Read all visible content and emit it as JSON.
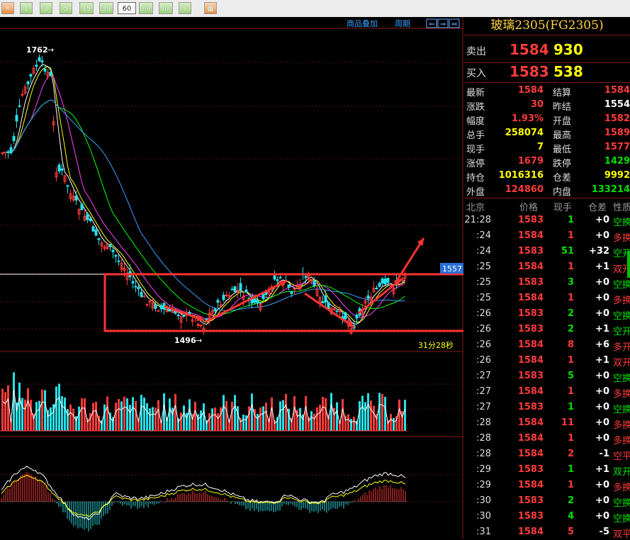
{
  "toolbar": {
    "buttons": [
      "1",
      "3",
      "5",
      "15",
      "30",
      "60",
      "2hr",
      "4hr",
      "Y"
    ],
    "active": "60"
  },
  "chart": {
    "links": [
      "商品叠加",
      "周期"
    ],
    "peak_label": "1762",
    "trough_label": "1496",
    "price_tag": "1557",
    "countdown": "31分28秒",
    "annotation_color": "#ff3333"
  },
  "panel": {
    "title": "玻璃2305(FG2305)",
    "sell": {
      "label": "卖出",
      "price": "1584",
      "volume": "930"
    },
    "buy": {
      "label": "买入",
      "price": "1583",
      "volume": "538"
    },
    "stats": [
      {
        "l1": "最新",
        "v1": "1584",
        "c1": "#ff3b3b",
        "l2": "结算",
        "v2": "1584",
        "c2": "#ff3b3b"
      },
      {
        "l1": "涨跌",
        "v1": "30",
        "c1": "#ff3b3b",
        "l2": "昨结",
        "v2": "1554",
        "c2": "#ffffff"
      },
      {
        "l1": "幅度",
        "v1": "1.93%",
        "c1": "#ff3b3b",
        "l2": "开盘",
        "v2": "1582",
        "c2": "#ff3b3b"
      },
      {
        "l1": "总手",
        "v1": "258074",
        "c1": "#ffff00",
        "l2": "最高",
        "v2": "1589",
        "c2": "#ff3b3b"
      },
      {
        "l1": "现手",
        "v1": "7",
        "c1": "#ffff00",
        "l2": "最低",
        "v2": "1577",
        "c2": "#ff3b3b"
      },
      {
        "l1": "涨停",
        "v1": "1679",
        "c1": "#ff3b3b",
        "l2": "跌停",
        "v2": "1429",
        "c2": "#00e000"
      },
      {
        "l1": "持仓",
        "v1": "1016316",
        "c1": "#ffff00",
        "l2": "仓差",
        "v2": "9992",
        "c2": "#ffff00"
      },
      {
        "l1": "外盘",
        "v1": "124860",
        "c1": "#ff3b3b",
        "l2": "内盘",
        "v2": "133214",
        "c2": "#00e000"
      }
    ],
    "tick_headers": [
      "北京",
      "价格",
      "现手",
      "仓差",
      "性质"
    ],
    "ticks": [
      {
        "time": "21:28",
        "price": "1583",
        "vol": "1",
        "vol_color": "#00e000",
        "diff": "+0",
        "kind": "空换",
        "kind_color": "#00e000"
      },
      {
        "time": ":24",
        "price": "1584",
        "vol": "1",
        "vol_color": "#ff3b3b",
        "diff": "+0",
        "kind": "多换",
        "kind_color": "#ff3b3b"
      },
      {
        "time": ":24",
        "price": "1583",
        "vol": "51",
        "vol_color": "#00e000",
        "diff": "+32",
        "kind": "空开",
        "kind_color": "#00e000"
      },
      {
        "time": ":25",
        "price": "1584",
        "vol": "1",
        "vol_color": "#ff3b3b",
        "diff": "+1",
        "kind": "双开",
        "kind_color": "#ff3b3b"
      },
      {
        "time": ":25",
        "price": "1583",
        "vol": "3",
        "vol_color": "#00e000",
        "diff": "+0",
        "kind": "空换",
        "kind_color": "#00e000"
      },
      {
        "time": ":25",
        "price": "1584",
        "vol": "1",
        "vol_color": "#ff3b3b",
        "diff": "+0",
        "kind": "多换",
        "kind_color": "#ff3b3b"
      },
      {
        "time": ":26",
        "price": "1583",
        "vol": "2",
        "vol_color": "#00e000",
        "diff": "+0",
        "kind": "空换",
        "kind_color": "#00e000"
      },
      {
        "time": ":26",
        "price": "1583",
        "vol": "2",
        "vol_color": "#00e000",
        "diff": "+1",
        "kind": "空开",
        "kind_color": "#00e000"
      },
      {
        "time": ":26",
        "price": "1584",
        "vol": "8",
        "vol_color": "#ff3b3b",
        "diff": "+6",
        "kind": "多开",
        "kind_color": "#ff3b3b"
      },
      {
        "time": ":26",
        "price": "1584",
        "vol": "1",
        "vol_color": "#ff3b3b",
        "diff": "+1",
        "kind": "双开",
        "kind_color": "#ff3b3b"
      },
      {
        "time": ":27",
        "price": "1583",
        "vol": "5",
        "vol_color": "#00e000",
        "diff": "+0",
        "kind": "空换",
        "kind_color": "#00e000"
      },
      {
        "time": ":27",
        "price": "1584",
        "vol": "1",
        "vol_color": "#ff3b3b",
        "diff": "+0",
        "kind": "多换",
        "kind_color": "#ff3b3b"
      },
      {
        "time": ":27",
        "price": "1583",
        "vol": "1",
        "vol_color": "#00e000",
        "diff": "+0",
        "kind": "空换",
        "kind_color": "#00e000"
      },
      {
        "time": ":28",
        "price": "1584",
        "vol": "11",
        "vol_color": "#ff3b3b",
        "diff": "+0",
        "kind": "多换",
        "kind_color": "#ff3b3b"
      },
      {
        "time": ":28",
        "price": "1584",
        "vol": "1",
        "vol_color": "#ff3b3b",
        "diff": "+0",
        "kind": "多换",
        "kind_color": "#ff3b3b"
      },
      {
        "time": ":28",
        "price": "1584",
        "vol": "2",
        "vol_color": "#ff3b3b",
        "diff": "-1",
        "kind": "空平",
        "kind_color": "#ff3b3b"
      },
      {
        "time": ":29",
        "price": "1583",
        "vol": "1",
        "vol_color": "#00e000",
        "diff": "+1",
        "kind": "双开",
        "kind_color": "#00e000"
      },
      {
        "time": ":29",
        "price": "1584",
        "vol": "1",
        "vol_color": "#ff3b3b",
        "diff": "+0",
        "kind": "多换",
        "kind_color": "#ff3b3b"
      },
      {
        "time": ":30",
        "price": "1583",
        "vol": "2",
        "vol_color": "#00e000",
        "diff": "+0",
        "kind": "空换",
        "kind_color": "#00e000"
      },
      {
        "time": ":30",
        "price": "1583",
        "vol": "4",
        "vol_color": "#00e000",
        "diff": "+0",
        "kind": "空换",
        "kind_color": "#00e000"
      },
      {
        "time": ":31",
        "price": "1584",
        "vol": "5",
        "vol_color": "#ff3b3b",
        "diff": "-5",
        "kind": "双平",
        "kind_color": "#ff3b3b"
      }
    ]
  }
}
